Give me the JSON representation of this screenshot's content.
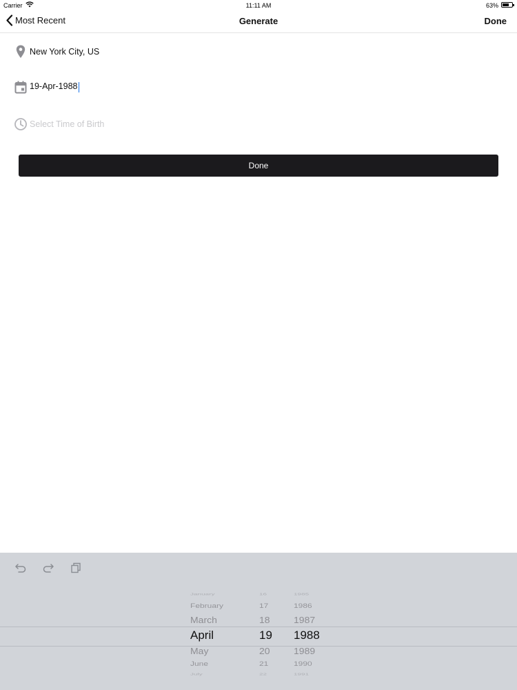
{
  "status_bar": {
    "carrier": "Carrier",
    "time": "11:11 AM",
    "battery_percent": "63%",
    "battery_level": 0.63
  },
  "nav": {
    "back_label": "Most Recent",
    "title": "Generate",
    "done_label": "Done"
  },
  "form": {
    "location_value": "New York City, US",
    "date_value": "19-Apr-1988",
    "time_placeholder": "Select Time of Birth",
    "done_button_label": "Done"
  },
  "picker": {
    "months": [
      "January",
      "February",
      "March",
      "April",
      "May",
      "June",
      "July"
    ],
    "days": [
      "16",
      "17",
      "18",
      "19",
      "20",
      "21",
      "22"
    ],
    "years": [
      "1985",
      "1986",
      "1987",
      "1988",
      "1989",
      "1990",
      "1991"
    ],
    "selected": {
      "month": "April",
      "day": "19",
      "year": "1988"
    }
  },
  "colors": {
    "accent_bar": "#1b1a1d",
    "keyboard_bg": "#d1d4d9",
    "caret": "#1a73e8",
    "placeholder": "#c9c9cc"
  }
}
